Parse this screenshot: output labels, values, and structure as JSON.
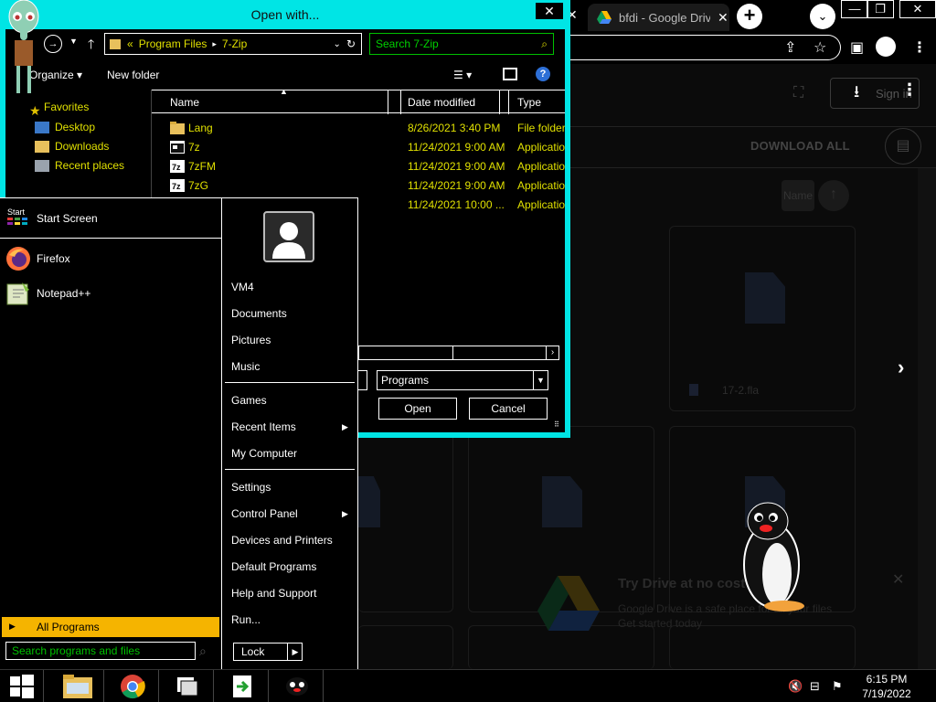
{
  "chrome": {
    "tab_title": "bfdi - Google Drive",
    "newtab_label": "+",
    "signin": "Sign in",
    "download_all": "DOWNLOAD ALL",
    "sort_name": "Name",
    "card_name": "17-2.fla",
    "toast_title": "Try Drive at no cost",
    "toast_body_line1": "Google Drive is a safe place for all your files",
    "toast_body_line2": "Get started today"
  },
  "dialog": {
    "title": "Open with...",
    "breadcrumb_sep": "«",
    "breadcrumb": [
      "Program Files",
      "7-Zip"
    ],
    "path_arrow": "▸",
    "search_placeholder": "Search 7-Zip",
    "organize": "Organize",
    "new_folder": "New folder",
    "nav": {
      "favorites": "Favorites",
      "desktop": "Desktop",
      "downloads": "Downloads",
      "recent": "Recent places"
    },
    "columns": {
      "name": "Name",
      "date": "Date modified",
      "type": "Type"
    },
    "files": [
      {
        "name": "Lang",
        "date": "8/26/2021 3:40 PM",
        "type": "File folder"
      },
      {
        "name": "7z",
        "date": "11/24/2021 9:00 AM",
        "type": "Application"
      },
      {
        "name": "7zFM",
        "date": "11/24/2021 9:00 AM",
        "type": "Application"
      },
      {
        "name": "7zG",
        "date": "11/24/2021 9:00 AM",
        "type": "Application"
      },
      {
        "name": "",
        "date": "11/24/2021 10:00 ...",
        "type": "Application"
      }
    ],
    "filter": "Programs",
    "open": "Open",
    "cancel": "Cancel"
  },
  "start_menu": {
    "start_small": "Start",
    "start_screen": "Start Screen",
    "programs": [
      "Firefox",
      "Notepad++"
    ],
    "all_programs": "All Programs",
    "search_placeholder": "Search programs and files",
    "user": "VM4",
    "right_items": {
      "documents": "Documents",
      "pictures": "Pictures",
      "music": "Music",
      "games": "Games",
      "recent_items": "Recent Items",
      "my_computer": "My Computer",
      "settings": "Settings",
      "control_panel": "Control Panel",
      "devices": "Devices and Printers",
      "default_programs": "Default Programs",
      "help": "Help and Support",
      "run": "Run..."
    },
    "lock": "Lock"
  },
  "taskbar": {
    "time": "6:15 PM",
    "date": "7/19/2022"
  },
  "colors": {
    "dialog_frame": "#00e5e5",
    "file_text": "#e0e000",
    "search_text": "#00c000",
    "all_programs_bg": "#f5b400"
  },
  "icons": [
    "windows-logo-icon",
    "file-explorer-icon",
    "chrome-icon",
    "firefox-icon",
    "notepadpp-icon",
    "google-drive-icon",
    "pingu-icon",
    "squidward-icon"
  ]
}
